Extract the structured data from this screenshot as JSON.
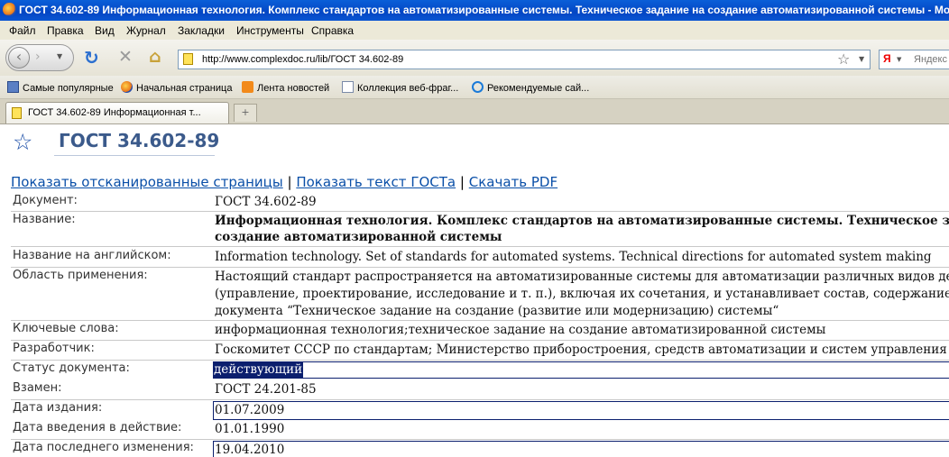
{
  "window": {
    "title": "ГОСТ 34.602-89 Информационная технология. Комплекс стандартов на автоматизированные системы. Техническое задание на создание автоматизированной системы - Mozilla Firefox"
  },
  "menu": [
    "Файл",
    "Правка",
    "Вид",
    "Журнал",
    "Закладки",
    "Инструменты",
    "Справка"
  ],
  "toolbar": {
    "url": "http://www.complexdoc.ru/lib/ГОСТ 34.602-89",
    "search_engine": "Я",
    "search_placeholder": "Яндекс"
  },
  "bookmarks": [
    {
      "label": "Самые популярные",
      "icon": "bookmark-folder-icon"
    },
    {
      "label": "Начальная страница",
      "icon": "firefox-icon"
    },
    {
      "label": "Лента новостей",
      "icon": "rss-feed-icon"
    },
    {
      "label": "Коллекция веб-фраг...",
      "icon": "page-icon"
    },
    {
      "label": "Рекомендуемые сай...",
      "icon": "ie-icon"
    }
  ],
  "tab": {
    "label": "ГОСТ 34.602-89 Информационная т...",
    "new_tab": "+"
  },
  "page": {
    "title": "ГОСТ 34.602-89",
    "links": {
      "scanned": "Показать отсканированные страницы",
      "text": "Показать текст ГОСТа",
      "pdf": "Скачать PDF",
      "sep": "|"
    },
    "fields": [
      {
        "label": "Документ:",
        "value": "ГОСТ 34.602-89"
      },
      {
        "label": "Название:",
        "value_lines": [
          "Информационная технология. Комплекс стандартов на автоматизированные системы. Техническое задание на",
          "создание автоматизированной системы"
        ]
      },
      {
        "label": "Название на английском:",
        "value": "Information technology. Set of standards for automated systems. Technical directions for automated system making"
      },
      {
        "label": "Область применения:",
        "value_lines": [
          "Настоящий стандарт распространяется на автоматизированные системы для автоматизации различных видов деятельности",
          "(управление, проектирование, исследование и т. п.), включая их сочетания, и устанавливает состав, содержание, правила оформления",
          "документа “Техническое задание на создание (развитие или модернизацию) системы“"
        ]
      },
      {
        "label": "Ключевые слова:",
        "value": "информационная технология;техническое задание на создание автоматизированной системы"
      },
      {
        "label": "Разработчик:",
        "value": "Госкомитет СССР по стандартам; Министерство приборостроения, средств автоматизации и систем управления СССР"
      },
      {
        "label": "Статус документа:",
        "value": "действующий"
      },
      {
        "label": "Взамен:",
        "value": "ГОСТ 24.201-85"
      },
      {
        "label": "Дата издания:",
        "value": "01.07.2009"
      },
      {
        "label": "Дата введения в действие:",
        "value": "01.01.1990"
      },
      {
        "label": "Дата последнего изменения:",
        "value": "19.04.2010"
      }
    ]
  }
}
